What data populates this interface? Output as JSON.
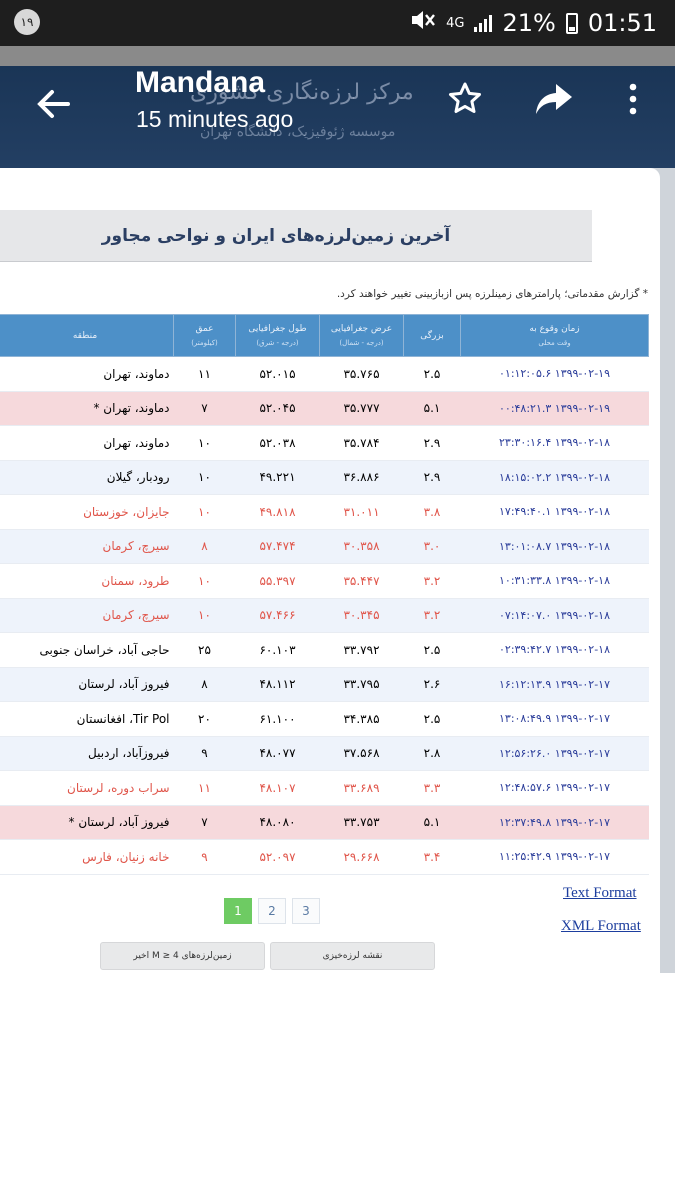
{
  "status_bar": {
    "notification_badge": "١٩",
    "network": "4G",
    "battery": "21%",
    "time": "01:51"
  },
  "app_bar": {
    "title": "Mandana",
    "subtitle": "15 minutes ago",
    "bg_heading": "مرکز لرزه‌نگاری کشوری",
    "bg_subheading": "موسسه ژئوفیزیک، دانشگاه تهران"
  },
  "page": {
    "section_title": "آخرین زمین‌لرزه‌های ایران و نواحی مجاور",
    "notice": "* گزارش مقدماتی؛ پارامترهای زمینلرزه پس ازبازبینی تغییر خواهند کرد.",
    "columns": [
      {
        "label": "زمان وقوع به",
        "sub": "وقت محلی"
      },
      {
        "label": "بزرگی",
        "sub": ""
      },
      {
        "label": "عرض جغرافیایی",
        "sub": "(درجه - شمال)"
      },
      {
        "label": "طول جغرافیایی",
        "sub": "(درجه - شرق)"
      },
      {
        "label": "عمق",
        "sub": "(کیلومتر)"
      },
      {
        "label": "منطقه",
        "sub": ""
      }
    ],
    "rows": [
      {
        "time": "۱۳۹۹-۰۲-۱۹ ۰۱:۱۲:۰۵.۶",
        "mag": "۲.۵",
        "lat": "۳۵.۷۶۵",
        "lon": "۵۲.۰۱۵",
        "depth": "۱۱",
        "region": "دماوند، تهران",
        "style": "normal"
      },
      {
        "time": "۱۳۹۹-۰۲-۱۹ ۰۰:۴۸:۲۱.۳",
        "mag": "۵.۱",
        "lat": "۳۵.۷۷۷",
        "lon": "۵۲.۰۴۵",
        "depth": "۷",
        "region": "دماوند، تهران *",
        "style": "big"
      },
      {
        "time": "۱۳۹۹-۰۲-۱۸ ۲۳:۳۰:۱۶.۴",
        "mag": "۲.۹",
        "lat": "۳۵.۷۸۴",
        "lon": "۵۲.۰۳۸",
        "depth": "۱۰",
        "region": "دماوند، تهران",
        "style": "normal"
      },
      {
        "time": "۱۳۹۹-۰۲-۱۸ ۱۸:۱۵:۰۲.۲",
        "mag": "۲.۹",
        "lat": "۳۶.۸۸۶",
        "lon": "۴۹.۲۲۱",
        "depth": "۱۰",
        "region": "رودبار، گیلان",
        "style": "alt"
      },
      {
        "time": "۱۳۹۹-۰۲-۱۸ ۱۷:۴۹:۴۰.۱",
        "mag": "۳.۸",
        "lat": "۳۱.۰۱۱",
        "lon": "۴۹.۸۱۸",
        "depth": "۱۰",
        "region": "جایزان، خوزستان",
        "style": "red"
      },
      {
        "time": "۱۳۹۹-۰۲-۱۸ ۱۳:۰۱:۰۸.۷",
        "mag": "۳.۰",
        "lat": "۳۰.۳۵۸",
        "lon": "۵۷.۴۷۴",
        "depth": "۸",
        "region": "سیرچ، کرمان",
        "style": "red-alt"
      },
      {
        "time": "۱۳۹۹-۰۲-۱۸ ۱۰:۳۱:۳۳.۸",
        "mag": "۳.۲",
        "lat": "۳۵.۴۴۷",
        "lon": "۵۵.۳۹۷",
        "depth": "۱۰",
        "region": "طرود، سمنان",
        "style": "red"
      },
      {
        "time": "۱۳۹۹-۰۲-۱۸ ۰۷:۱۴:۰۷.۰",
        "mag": "۳.۲",
        "lat": "۳۰.۳۴۵",
        "lon": "۵۷.۴۶۶",
        "depth": "۱۰",
        "region": "سیرچ، کرمان",
        "style": "red-alt"
      },
      {
        "time": "۱۳۹۹-۰۲-۱۸ ۰۲:۳۹:۴۲.۷",
        "mag": "۲.۵",
        "lat": "۳۳.۷۹۲",
        "lon": "۶۰.۱۰۳",
        "depth": "۲۵",
        "region": "حاجی آباد، خراسان جنوبی",
        "style": "normal"
      },
      {
        "time": "۱۳۹۹-۰۲-۱۷ ۱۶:۱۲:۱۳.۹",
        "mag": "۲.۶",
        "lat": "۳۳.۷۹۵",
        "lon": "۴۸.۱۱۲",
        "depth": "۸",
        "region": "فیروز آباد، لرستان",
        "style": "alt"
      },
      {
        "time": "۱۳۹۹-۰۲-۱۷ ۱۳:۰۸:۴۹.۹",
        "mag": "۲.۵",
        "lat": "۳۴.۳۸۵",
        "lon": "۶۱.۱۰۰",
        "depth": "۲۰",
        "region": "Tir Pol، افغانستان",
        "style": "normal"
      },
      {
        "time": "۱۳۹۹-۰۲-۱۷ ۱۲:۵۶:۲۶.۰",
        "mag": "۲.۸",
        "lat": "۳۷.۵۶۸",
        "lon": "۴۸.۰۷۷",
        "depth": "۹",
        "region": "فیروزآباد، اردبیل",
        "style": "alt"
      },
      {
        "time": "۱۳۹۹-۰۲-۱۷ ۱۲:۴۸:۵۷.۶",
        "mag": "۳.۳",
        "lat": "۳۳.۶۸۹",
        "lon": "۴۸.۱۰۷",
        "depth": "۱۱",
        "region": "سراب دوره، لرستان",
        "style": "red"
      },
      {
        "time": "۱۳۹۹-۰۲-۱۷ ۱۲:۳۷:۴۹.۸",
        "mag": "۵.۱",
        "lat": "۳۳.۷۵۳",
        "lon": "۴۸.۰۸۰",
        "depth": "۷",
        "region": "فیروز آباد، لرستان *",
        "style": "big"
      },
      {
        "time": "۱۳۹۹-۰۲-۱۷ ۱۱:۲۵:۴۲.۹",
        "mag": "۳.۴",
        "lat": "۲۹.۶۶۸",
        "lon": "۵۲.۰۹۷",
        "depth": "۹",
        "region": "خانه زنیان، فارس",
        "style": "red"
      }
    ],
    "pages": [
      "1",
      "2",
      "3"
    ],
    "active_page": "1",
    "text_format_link": "Text Format",
    "xml_format_link": "XML Format",
    "btn_map": "نقشه لرزه‌خیزی",
    "btn_recent": "زمین‌لرزه‌های M ≥ 4 اخیر"
  }
}
